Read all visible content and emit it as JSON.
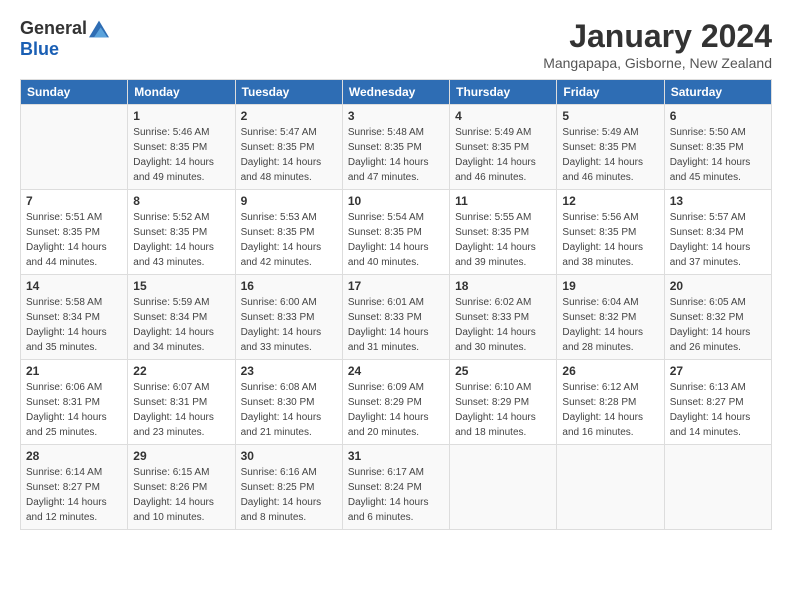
{
  "logo": {
    "general": "General",
    "blue": "Blue"
  },
  "title": "January 2024",
  "location": "Mangapapa, Gisborne, New Zealand",
  "weekdays": [
    "Sunday",
    "Monday",
    "Tuesday",
    "Wednesday",
    "Thursday",
    "Friday",
    "Saturday"
  ],
  "weeks": [
    [
      {
        "day": "",
        "sunrise": "",
        "sunset": "",
        "daylight": ""
      },
      {
        "day": "1",
        "sunrise": "Sunrise: 5:46 AM",
        "sunset": "Sunset: 8:35 PM",
        "daylight": "Daylight: 14 hours and 49 minutes."
      },
      {
        "day": "2",
        "sunrise": "Sunrise: 5:47 AM",
        "sunset": "Sunset: 8:35 PM",
        "daylight": "Daylight: 14 hours and 48 minutes."
      },
      {
        "day": "3",
        "sunrise": "Sunrise: 5:48 AM",
        "sunset": "Sunset: 8:35 PM",
        "daylight": "Daylight: 14 hours and 47 minutes."
      },
      {
        "day": "4",
        "sunrise": "Sunrise: 5:49 AM",
        "sunset": "Sunset: 8:35 PM",
        "daylight": "Daylight: 14 hours and 46 minutes."
      },
      {
        "day": "5",
        "sunrise": "Sunrise: 5:49 AM",
        "sunset": "Sunset: 8:35 PM",
        "daylight": "Daylight: 14 hours and 46 minutes."
      },
      {
        "day": "6",
        "sunrise": "Sunrise: 5:50 AM",
        "sunset": "Sunset: 8:35 PM",
        "daylight": "Daylight: 14 hours and 45 minutes."
      }
    ],
    [
      {
        "day": "7",
        "sunrise": "Sunrise: 5:51 AM",
        "sunset": "Sunset: 8:35 PM",
        "daylight": "Daylight: 14 hours and 44 minutes."
      },
      {
        "day": "8",
        "sunrise": "Sunrise: 5:52 AM",
        "sunset": "Sunset: 8:35 PM",
        "daylight": "Daylight: 14 hours and 43 minutes."
      },
      {
        "day": "9",
        "sunrise": "Sunrise: 5:53 AM",
        "sunset": "Sunset: 8:35 PM",
        "daylight": "Daylight: 14 hours and 42 minutes."
      },
      {
        "day": "10",
        "sunrise": "Sunrise: 5:54 AM",
        "sunset": "Sunset: 8:35 PM",
        "daylight": "Daylight: 14 hours and 40 minutes."
      },
      {
        "day": "11",
        "sunrise": "Sunrise: 5:55 AM",
        "sunset": "Sunset: 8:35 PM",
        "daylight": "Daylight: 14 hours and 39 minutes."
      },
      {
        "day": "12",
        "sunrise": "Sunrise: 5:56 AM",
        "sunset": "Sunset: 8:35 PM",
        "daylight": "Daylight: 14 hours and 38 minutes."
      },
      {
        "day": "13",
        "sunrise": "Sunrise: 5:57 AM",
        "sunset": "Sunset: 8:34 PM",
        "daylight": "Daylight: 14 hours and 37 minutes."
      }
    ],
    [
      {
        "day": "14",
        "sunrise": "Sunrise: 5:58 AM",
        "sunset": "Sunset: 8:34 PM",
        "daylight": "Daylight: 14 hours and 35 minutes."
      },
      {
        "day": "15",
        "sunrise": "Sunrise: 5:59 AM",
        "sunset": "Sunset: 8:34 PM",
        "daylight": "Daylight: 14 hours and 34 minutes."
      },
      {
        "day": "16",
        "sunrise": "Sunrise: 6:00 AM",
        "sunset": "Sunset: 8:33 PM",
        "daylight": "Daylight: 14 hours and 33 minutes."
      },
      {
        "day": "17",
        "sunrise": "Sunrise: 6:01 AM",
        "sunset": "Sunset: 8:33 PM",
        "daylight": "Daylight: 14 hours and 31 minutes."
      },
      {
        "day": "18",
        "sunrise": "Sunrise: 6:02 AM",
        "sunset": "Sunset: 8:33 PM",
        "daylight": "Daylight: 14 hours and 30 minutes."
      },
      {
        "day": "19",
        "sunrise": "Sunrise: 6:04 AM",
        "sunset": "Sunset: 8:32 PM",
        "daylight": "Daylight: 14 hours and 28 minutes."
      },
      {
        "day": "20",
        "sunrise": "Sunrise: 6:05 AM",
        "sunset": "Sunset: 8:32 PM",
        "daylight": "Daylight: 14 hours and 26 minutes."
      }
    ],
    [
      {
        "day": "21",
        "sunrise": "Sunrise: 6:06 AM",
        "sunset": "Sunset: 8:31 PM",
        "daylight": "Daylight: 14 hours and 25 minutes."
      },
      {
        "day": "22",
        "sunrise": "Sunrise: 6:07 AM",
        "sunset": "Sunset: 8:31 PM",
        "daylight": "Daylight: 14 hours and 23 minutes."
      },
      {
        "day": "23",
        "sunrise": "Sunrise: 6:08 AM",
        "sunset": "Sunset: 8:30 PM",
        "daylight": "Daylight: 14 hours and 21 minutes."
      },
      {
        "day": "24",
        "sunrise": "Sunrise: 6:09 AM",
        "sunset": "Sunset: 8:29 PM",
        "daylight": "Daylight: 14 hours and 20 minutes."
      },
      {
        "day": "25",
        "sunrise": "Sunrise: 6:10 AM",
        "sunset": "Sunset: 8:29 PM",
        "daylight": "Daylight: 14 hours and 18 minutes."
      },
      {
        "day": "26",
        "sunrise": "Sunrise: 6:12 AM",
        "sunset": "Sunset: 8:28 PM",
        "daylight": "Daylight: 14 hours and 16 minutes."
      },
      {
        "day": "27",
        "sunrise": "Sunrise: 6:13 AM",
        "sunset": "Sunset: 8:27 PM",
        "daylight": "Daylight: 14 hours and 14 minutes."
      }
    ],
    [
      {
        "day": "28",
        "sunrise": "Sunrise: 6:14 AM",
        "sunset": "Sunset: 8:27 PM",
        "daylight": "Daylight: 14 hours and 12 minutes."
      },
      {
        "day": "29",
        "sunrise": "Sunrise: 6:15 AM",
        "sunset": "Sunset: 8:26 PM",
        "daylight": "Daylight: 14 hours and 10 minutes."
      },
      {
        "day": "30",
        "sunrise": "Sunrise: 6:16 AM",
        "sunset": "Sunset: 8:25 PM",
        "daylight": "Daylight: 14 hours and 8 minutes."
      },
      {
        "day": "31",
        "sunrise": "Sunrise: 6:17 AM",
        "sunset": "Sunset: 8:24 PM",
        "daylight": "Daylight: 14 hours and 6 minutes."
      },
      {
        "day": "",
        "sunrise": "",
        "sunset": "",
        "daylight": ""
      },
      {
        "day": "",
        "sunrise": "",
        "sunset": "",
        "daylight": ""
      },
      {
        "day": "",
        "sunrise": "",
        "sunset": "",
        "daylight": ""
      }
    ]
  ]
}
